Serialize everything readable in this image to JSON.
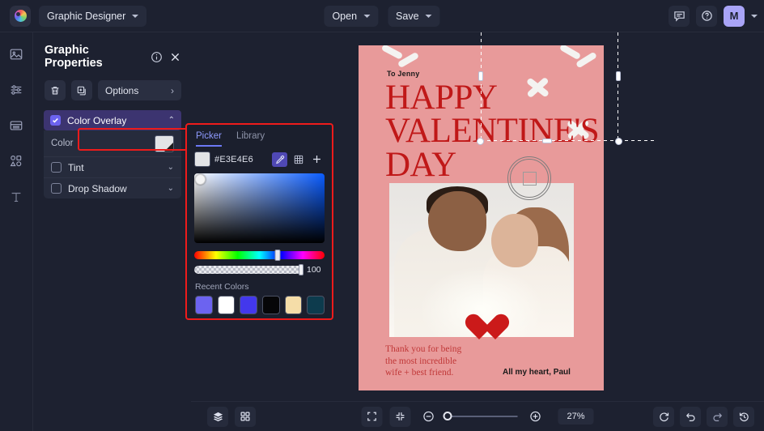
{
  "topbar": {
    "logo_icon": "color-wheel-logo",
    "app_name": "Graphic Designer",
    "open_label": "Open",
    "save_label": "Save",
    "comment_icon": "comment-icon",
    "help_icon": "help-circle-icon",
    "avatar_initial": "M"
  },
  "rail": {
    "items": [
      {
        "icon": "image-icon",
        "name": "sidebar-item-image"
      },
      {
        "icon": "adjustments-icon",
        "name": "sidebar-item-adjustments"
      },
      {
        "icon": "layers-panel-icon",
        "name": "sidebar-item-layout"
      },
      {
        "icon": "shapes-icon",
        "name": "sidebar-item-shapes"
      },
      {
        "icon": "text-icon",
        "name": "sidebar-item-text"
      }
    ]
  },
  "panel": {
    "title": "Graphic Properties",
    "info_icon": "info-icon",
    "close_icon": "close-icon",
    "delete_icon": "trash-icon",
    "duplicate_icon": "duplicate-icon",
    "options_label": "Options",
    "options_chevron": "›",
    "sections": [
      {
        "label": "Color Overlay",
        "checked": true,
        "expanded": true,
        "chevron": "⌃"
      },
      {
        "label": "Tint",
        "checked": false,
        "expanded": false,
        "chevron": "⌄"
      },
      {
        "label": "Drop Shadow",
        "checked": false,
        "expanded": false,
        "chevron": "⌄"
      }
    ],
    "color_label": "Color",
    "color_value": "#E3E4E6"
  },
  "picker": {
    "tabs": [
      {
        "label": "Picker",
        "active": true
      },
      {
        "label": "Library",
        "active": false
      }
    ],
    "hex_value": "#E3E4E6",
    "eyedropper_icon": "eyedropper-icon",
    "grid_icon": "grid-icon",
    "add_icon": "plus-icon",
    "alpha_value": "100",
    "recent_label": "Recent Colors",
    "recent_colors": [
      "#6c63f0",
      "#ffffff",
      "#4338ec",
      "#060608",
      "#f5dda8",
      "#0d3b4d"
    ],
    "accent": "#6c78f5",
    "annotation_color": "#ee1b1b"
  },
  "canvas": {
    "card": {
      "background": "#e89a9a",
      "to_line": "To Jenny",
      "headline": "HAPPY VALENTINE'S DAY",
      "headline_color": "#c01818",
      "note": "Thank you for being the most incredible wife + best friend.",
      "signature": "All my heart, Paul",
      "heart_icon": "heart-icon",
      "photo_alt": "couple-photo"
    },
    "selection": {
      "name": "selection-bounding-box"
    },
    "crop_widget_icon": "crop-square-icon"
  },
  "bottombar": {
    "layers_icon": "layers-icon",
    "grid_view_icon": "grid-view-icon",
    "fit_icon": "fit-screen-icon",
    "shrink_icon": "shrink-icon",
    "zoom_out_icon": "zoom-out-icon",
    "zoom_in_icon": "zoom-in-icon",
    "zoom_percent": "27%",
    "reset_icon": "reset-icon",
    "undo_icon": "undo-icon",
    "redo_icon": "redo-icon",
    "history_icon": "history-icon"
  }
}
